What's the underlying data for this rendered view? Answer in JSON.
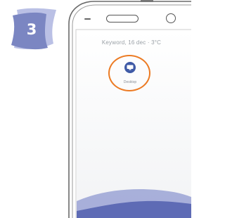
{
  "step": {
    "number": "3"
  },
  "phone": {
    "status_line": "Keyword, 16 dec · 3°C",
    "app": {
      "label": "Desktop"
    }
  },
  "colors": {
    "badge": "#7b86c2",
    "highlight": "#ec7b24",
    "app_icon": "#3f5aa6",
    "wave_back": "#7e87c9",
    "wave_front": "#5e6bb5"
  }
}
